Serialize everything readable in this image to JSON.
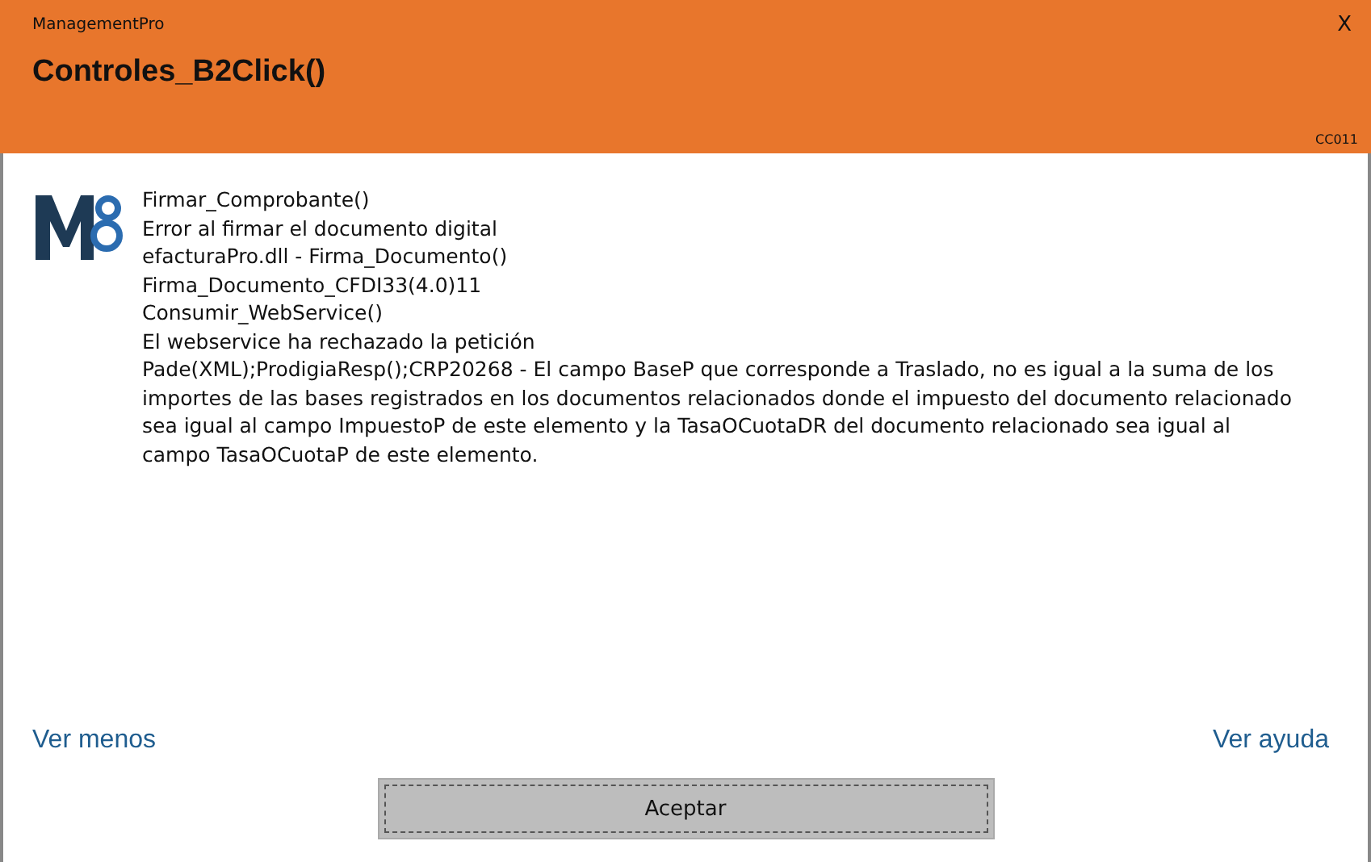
{
  "window": {
    "app_name": "ManagementPro",
    "close": "X",
    "title": "Controles_B2Click()",
    "code": "CC011"
  },
  "message": {
    "lines": [
      "Firmar_Comprobante()",
      "Error al firmar el documento digital",
      "efacturaPro.dll - Firma_Documento()",
      "Firma_Documento_CFDI33(4.0)11",
      "Consumir_WebService()",
      "El webservice ha rechazado la petición",
      "Pade(XML);ProdigiaResp();CRP20268 - El campo BaseP que corresponde a Traslado, no es igual a la suma de los importes de las bases registrados en los documentos relacionados donde el impuesto del documento relacionado sea igual al campo ImpuestoP de este elemento y la TasaOCuotaDR del documento relacionado sea igual al campo TasaOCuotaP de este elemento."
    ]
  },
  "links": [
    "Ver menos",
    "Ver ayuda"
  ],
  "button": "Aceptar"
}
